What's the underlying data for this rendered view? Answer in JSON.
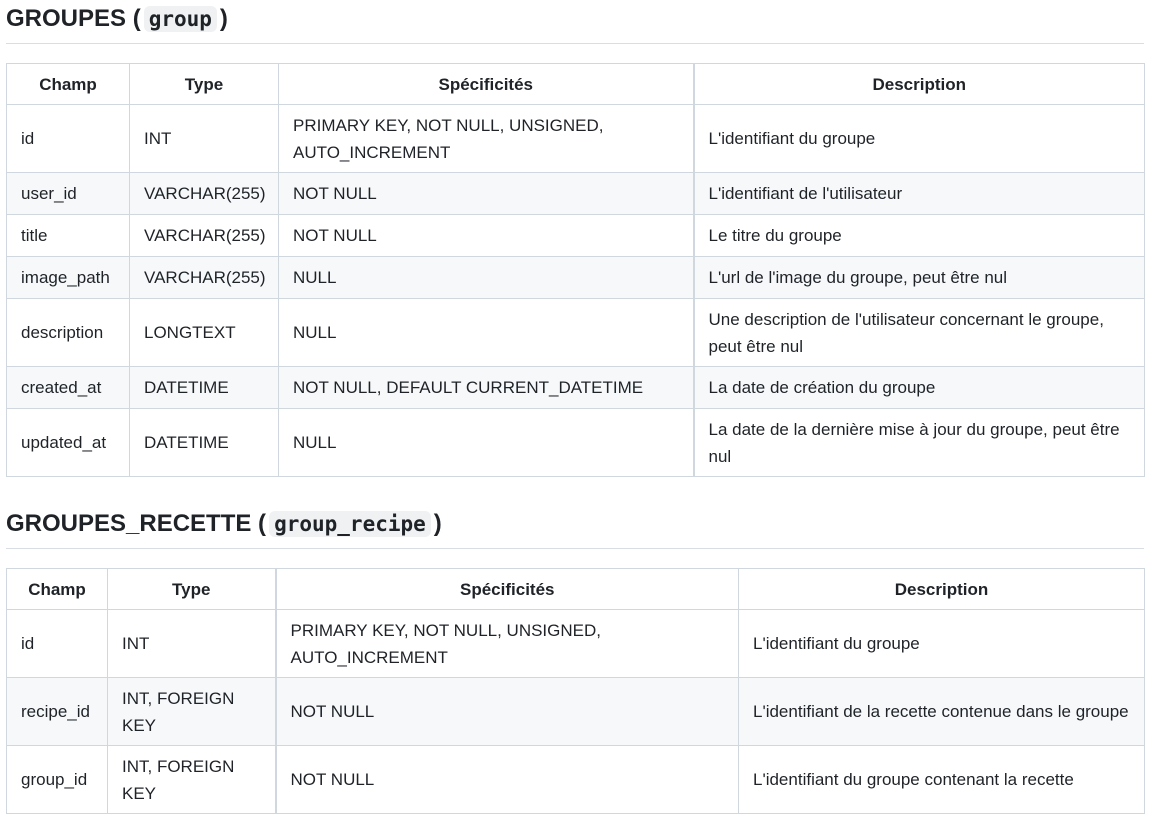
{
  "groups_section": {
    "title_text": "GROUPES",
    "title_code": "group",
    "headers": [
      "Champ",
      "Type",
      "Spécificités",
      "Description"
    ],
    "rows": [
      {
        "field": "id",
        "type": "INT",
        "specs": "PRIMARY KEY, NOT NULL, UNSIGNED, AUTO_INCREMENT",
        "description": "L'identifiant du groupe"
      },
      {
        "field": "user_id",
        "type": "VARCHAR(255)",
        "specs": "NOT NULL",
        "description": "L'identifiant de l'utilisateur"
      },
      {
        "field": "title",
        "type": "VARCHAR(255)",
        "specs": "NOT NULL",
        "description": "Le titre du groupe"
      },
      {
        "field": "image_path",
        "type": "VARCHAR(255)",
        "specs": "NULL",
        "description": "L'url de l'image du groupe, peut être nul"
      },
      {
        "field": "description",
        "type": "LONGTEXT",
        "specs": "NULL",
        "description": "Une description de l'utilisateur concernant le groupe, peut être nul"
      },
      {
        "field": "created_at",
        "type": "DATETIME",
        "specs": "NOT NULL, DEFAULT CURRENT_DATETIME",
        "description": "La date de création du groupe"
      },
      {
        "field": "updated_at",
        "type": "DATETIME",
        "specs": "NULL",
        "description": "La date de la dernière mise à jour du groupe, peut être nul"
      }
    ]
  },
  "group_recipe_section": {
    "title_text": "GROUPES_RECETTE",
    "title_code": "group_recipe",
    "headers": [
      "Champ",
      "Type",
      "Spécificités",
      "Description"
    ],
    "rows": [
      {
        "field": "id",
        "type": "INT",
        "specs": "PRIMARY KEY, NOT NULL, UNSIGNED, AUTO_INCREMENT",
        "description": "L'identifiant du groupe"
      },
      {
        "field": "recipe_id",
        "type": "INT, FOREIGN KEY",
        "specs": "NOT NULL",
        "description": "L'identifiant de la recette contenue dans le groupe"
      },
      {
        "field": "group_id",
        "type": "INT, FOREIGN KEY",
        "specs": "NOT NULL",
        "description": "L'identifiant du groupe contenant la recette"
      }
    ]
  }
}
